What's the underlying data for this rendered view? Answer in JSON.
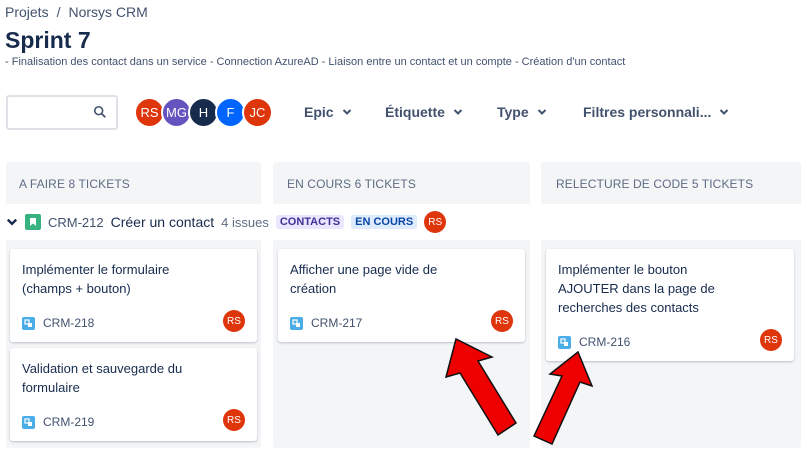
{
  "breadcrumb": {
    "items": [
      "Projets",
      "Norsys CRM"
    ],
    "separator": "/"
  },
  "page": {
    "title": "Sprint 7",
    "subtitle": "- Finalisation des contact dans un service - Connection AzureAD - Liaison entre un contact et un compte - Création d'un contact"
  },
  "search": {
    "value": "",
    "placeholder": ""
  },
  "avatars": [
    {
      "initials": "RS",
      "color": "#de350b"
    },
    {
      "initials": "MG",
      "color": "#6554c0"
    },
    {
      "initials": "H",
      "color": "#172b4d"
    },
    {
      "initials": "F",
      "color": "#0065ff"
    },
    {
      "initials": "JC",
      "color": "#de350b"
    }
  ],
  "filters": {
    "epic": "Epic",
    "label": "Étiquette",
    "type": "Type",
    "custom": "Filtres personnali..."
  },
  "columns": [
    {
      "title": "A FAIRE 8 TICKETS"
    },
    {
      "title": "EN COURS 6 TICKETS"
    },
    {
      "title": "RELECTURE DE CODE 5 TICKETS"
    }
  ],
  "swimlane": {
    "key": "CRM-212",
    "name": "Créer un contact",
    "count": "4 issues",
    "badge1": "CONTACTS",
    "badge2": "EN COURS",
    "assignee": "RS"
  },
  "cards": {
    "c218": {
      "text": "Implémenter le formulaire (champs + bouton)",
      "key": "CRM-218",
      "assignee": "RS"
    },
    "c219": {
      "text": "Validation et sauvegarde du formulaire",
      "key": "CRM-219",
      "assignee": "RS"
    },
    "c217": {
      "text": "Afficher une page vide de création",
      "key": "CRM-217",
      "assignee": "RS"
    },
    "c216": {
      "text": "Implémenter le bouton AJOUTER dans la page de recherches des contacts",
      "key": "CRM-216",
      "assignee": "RS"
    }
  },
  "colors": {
    "accent": "#0052cc",
    "assignee": "#de350b",
    "annotation_arrow": "#ee0000"
  }
}
